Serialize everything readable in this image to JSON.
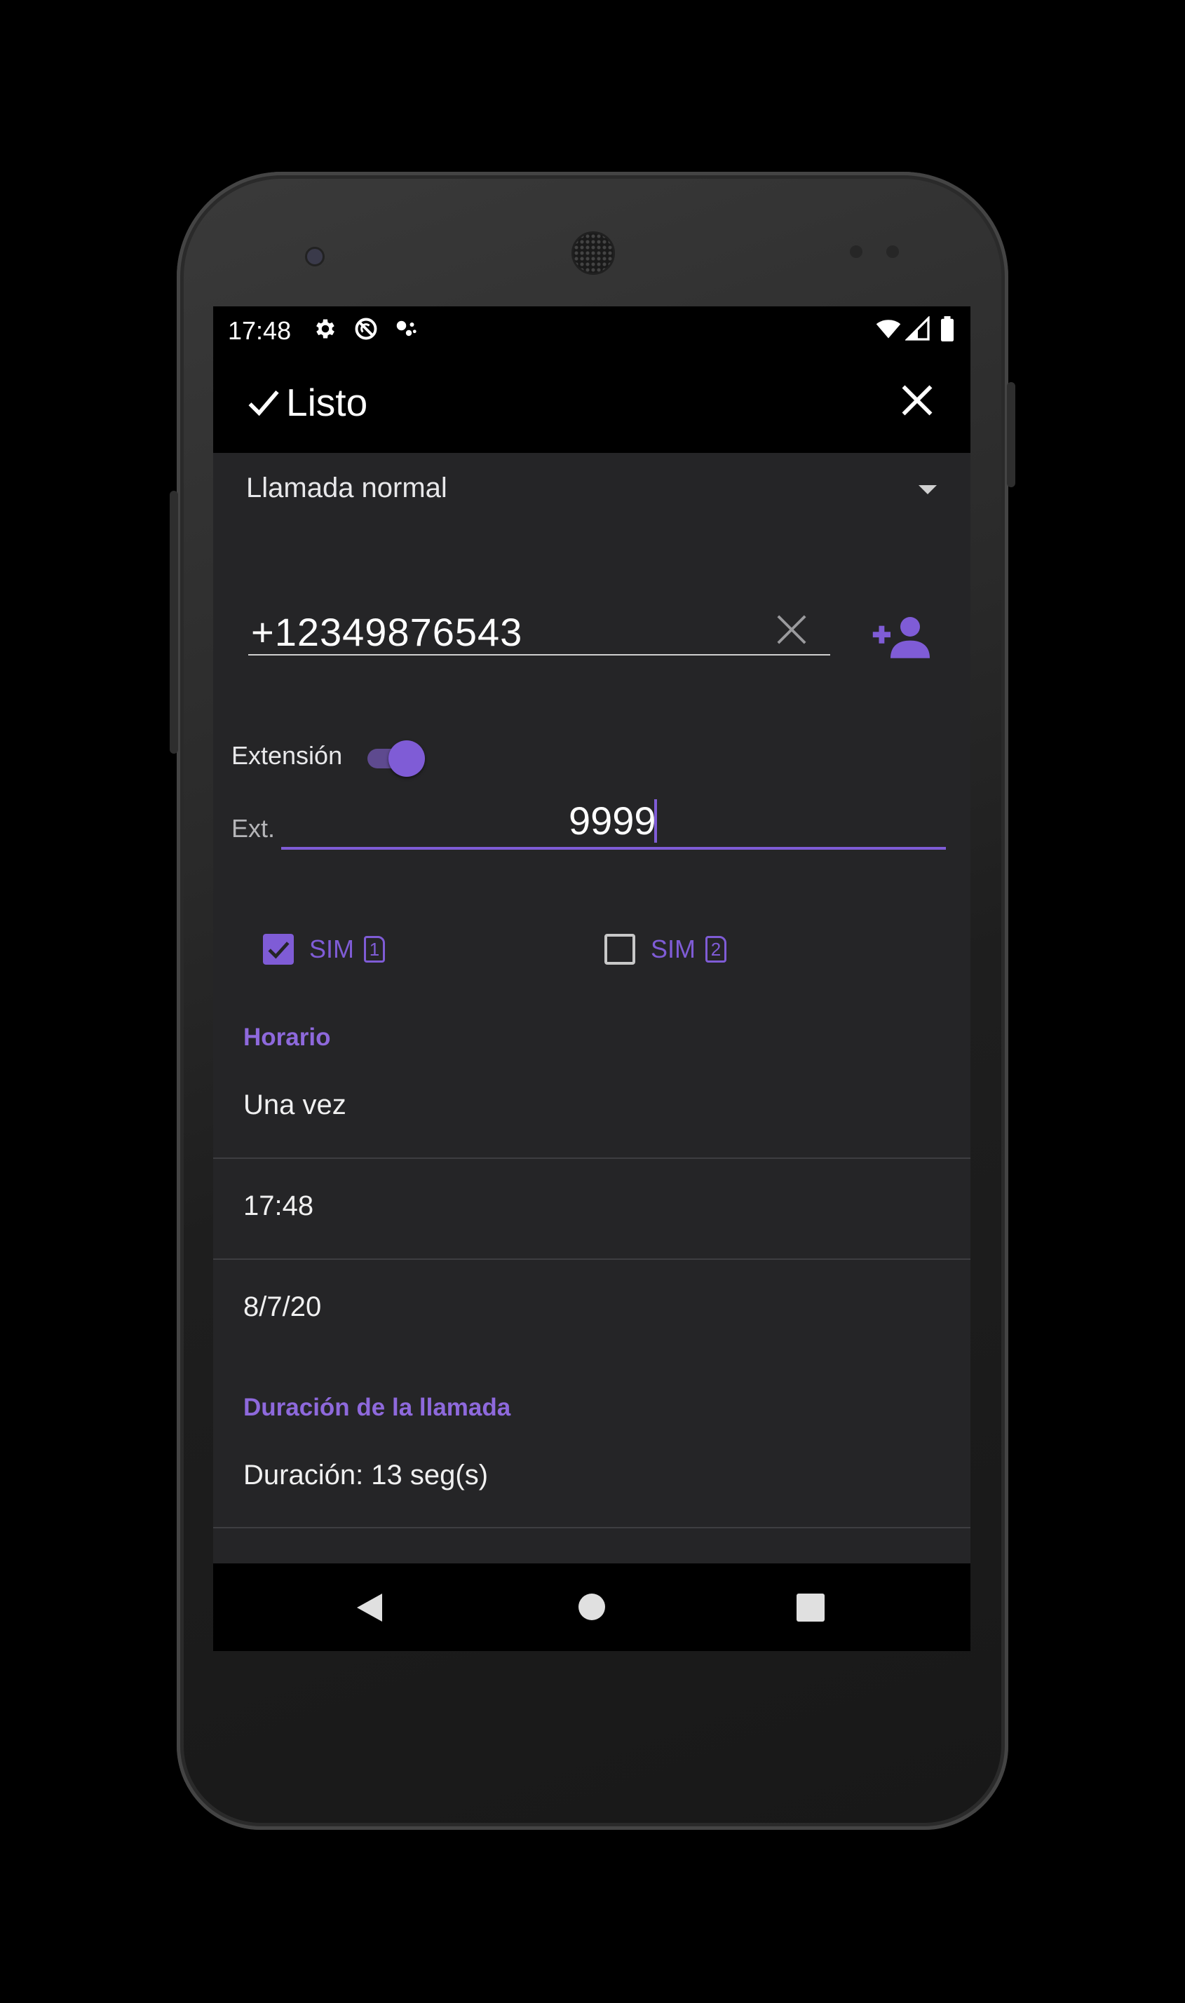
{
  "status_bar": {
    "time": "17:48",
    "left_icons": [
      "settings-icon",
      "do-not-disturb-icon",
      "assistant-icon"
    ],
    "right_icons": [
      "wifi-icon",
      "signal-icon",
      "battery-icon"
    ]
  },
  "app_bar": {
    "done_label": "Listo",
    "done_icon": "check-icon",
    "close_icon": "close-icon"
  },
  "call_type": {
    "selected": "Llamada normal"
  },
  "phone_number": {
    "value": "+12349876543",
    "clear_icon": "clear-icon",
    "contact_icon": "add-contact-icon"
  },
  "extension": {
    "toggle_label": "Extensión",
    "enabled": true,
    "field_label": "Ext.",
    "value": "9999"
  },
  "sims": [
    {
      "label": "SIM",
      "number": "1",
      "checked": true
    },
    {
      "label": "SIM",
      "number": "2",
      "checked": false
    }
  ],
  "schedule": {
    "header": "Horario",
    "repeat": "Una vez",
    "time": "17:48",
    "date": "8/7/20"
  },
  "duration": {
    "header": "Duración de la llamada",
    "value": "Duración: 13 seg(s)"
  },
  "colors": {
    "accent": "#7f5cd6",
    "background": "#252527",
    "bar": "#000000"
  },
  "nav_bar": {
    "icons": [
      "back-icon",
      "home-icon",
      "recents-icon"
    ]
  }
}
